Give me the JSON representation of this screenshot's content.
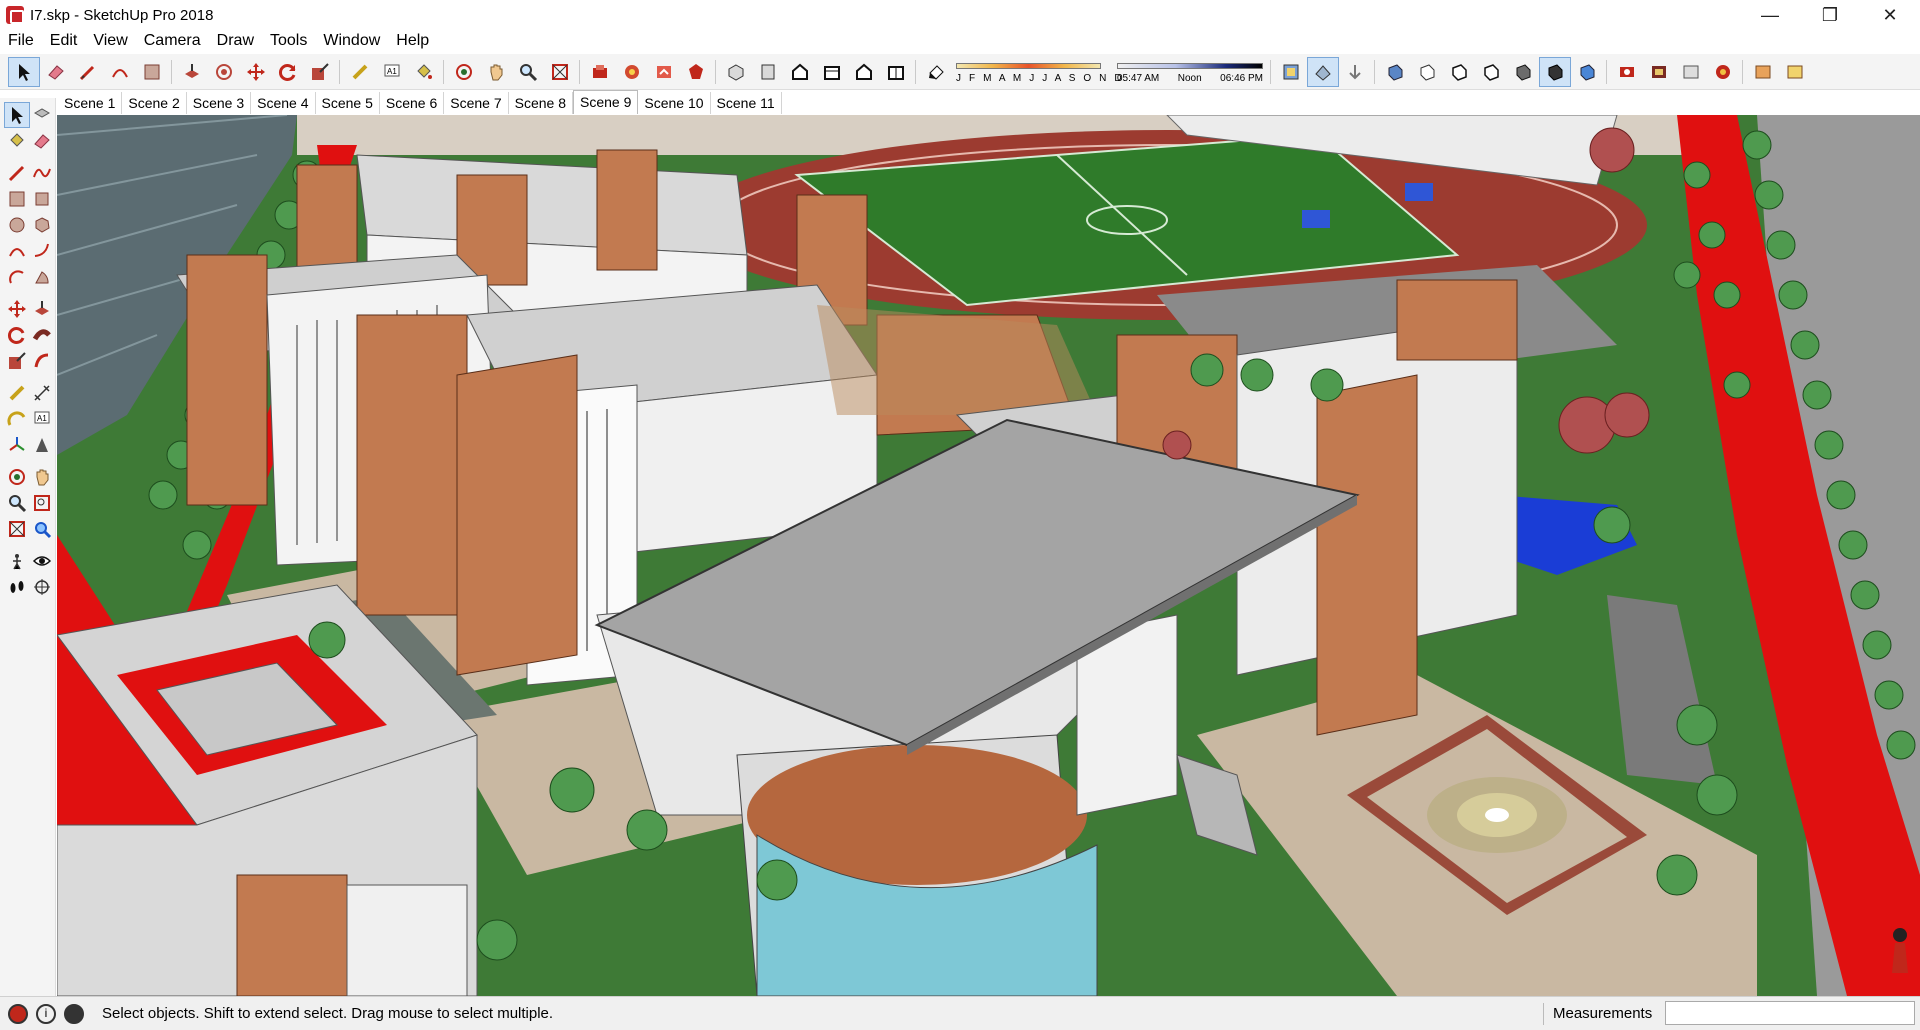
{
  "window": {
    "title": "I7.skp - SketchUp Pro 2018",
    "app_icon": "sketchup-logo-icon",
    "controls": [
      "minimize-icon",
      "restore-icon",
      "close-icon"
    ]
  },
  "menu": [
    "File",
    "Edit",
    "View",
    "Camera",
    "Draw",
    "Tools",
    "Window",
    "Help"
  ],
  "toolbar": {
    "shadow_months": "J F M A M J J A S O N D",
    "time_start": "05:47 AM",
    "time_mid": "Noon",
    "time_end": "06:46 PM"
  },
  "scenes": {
    "tabs": [
      "Scene 1",
      "Scene 2",
      "Scene 3",
      "Scene 4",
      "Scene 5",
      "Scene 6",
      "Scene 7",
      "Scene 8",
      "Scene 9",
      "Scene 10",
      "Scene 11"
    ],
    "active": "Scene 9"
  },
  "status": {
    "message": "Select objects. Shift to extend select. Drag mouse to select multiple.",
    "measurements_label": "Measurements",
    "measurements_value": ""
  },
  "colors": {
    "accent_red": "#e01010",
    "grass": "#3f7a37",
    "building_brick": "#c27a50",
    "roof_gray": "#a4a4a4",
    "track_red": "#9c3b30",
    "water_blue": "#1a3dd6"
  }
}
